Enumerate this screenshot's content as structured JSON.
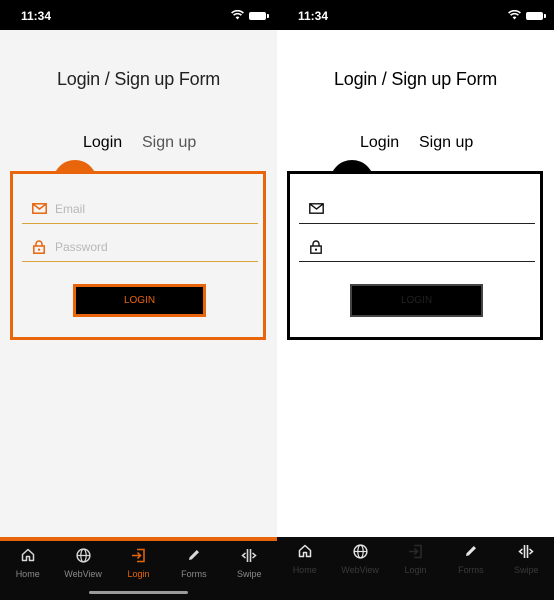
{
  "status_bar": {
    "time": "11:34"
  },
  "form": {
    "title": "Login / Sign up Form",
    "tabs": [
      "Login",
      "Sign up"
    ],
    "email_placeholder": "Email",
    "password_placeholder": "Password",
    "login_button_label": "LOGIN"
  },
  "tab_bar": {
    "items": [
      {
        "label": "Home",
        "icon": "home-icon"
      },
      {
        "label": "WebView",
        "icon": "globe-icon"
      },
      {
        "label": "Login",
        "icon": "login-icon"
      },
      {
        "label": "Forms",
        "icon": "pencil-icon"
      },
      {
        "label": "Swipe",
        "icon": "swipe-icon"
      }
    ],
    "active_index": 2
  },
  "colors": {
    "accent": "#e8650c",
    "bar": "#0b0b0b",
    "screen_left_bg": "#f4f4f4",
    "screen_right_bg": "#ffffff"
  }
}
